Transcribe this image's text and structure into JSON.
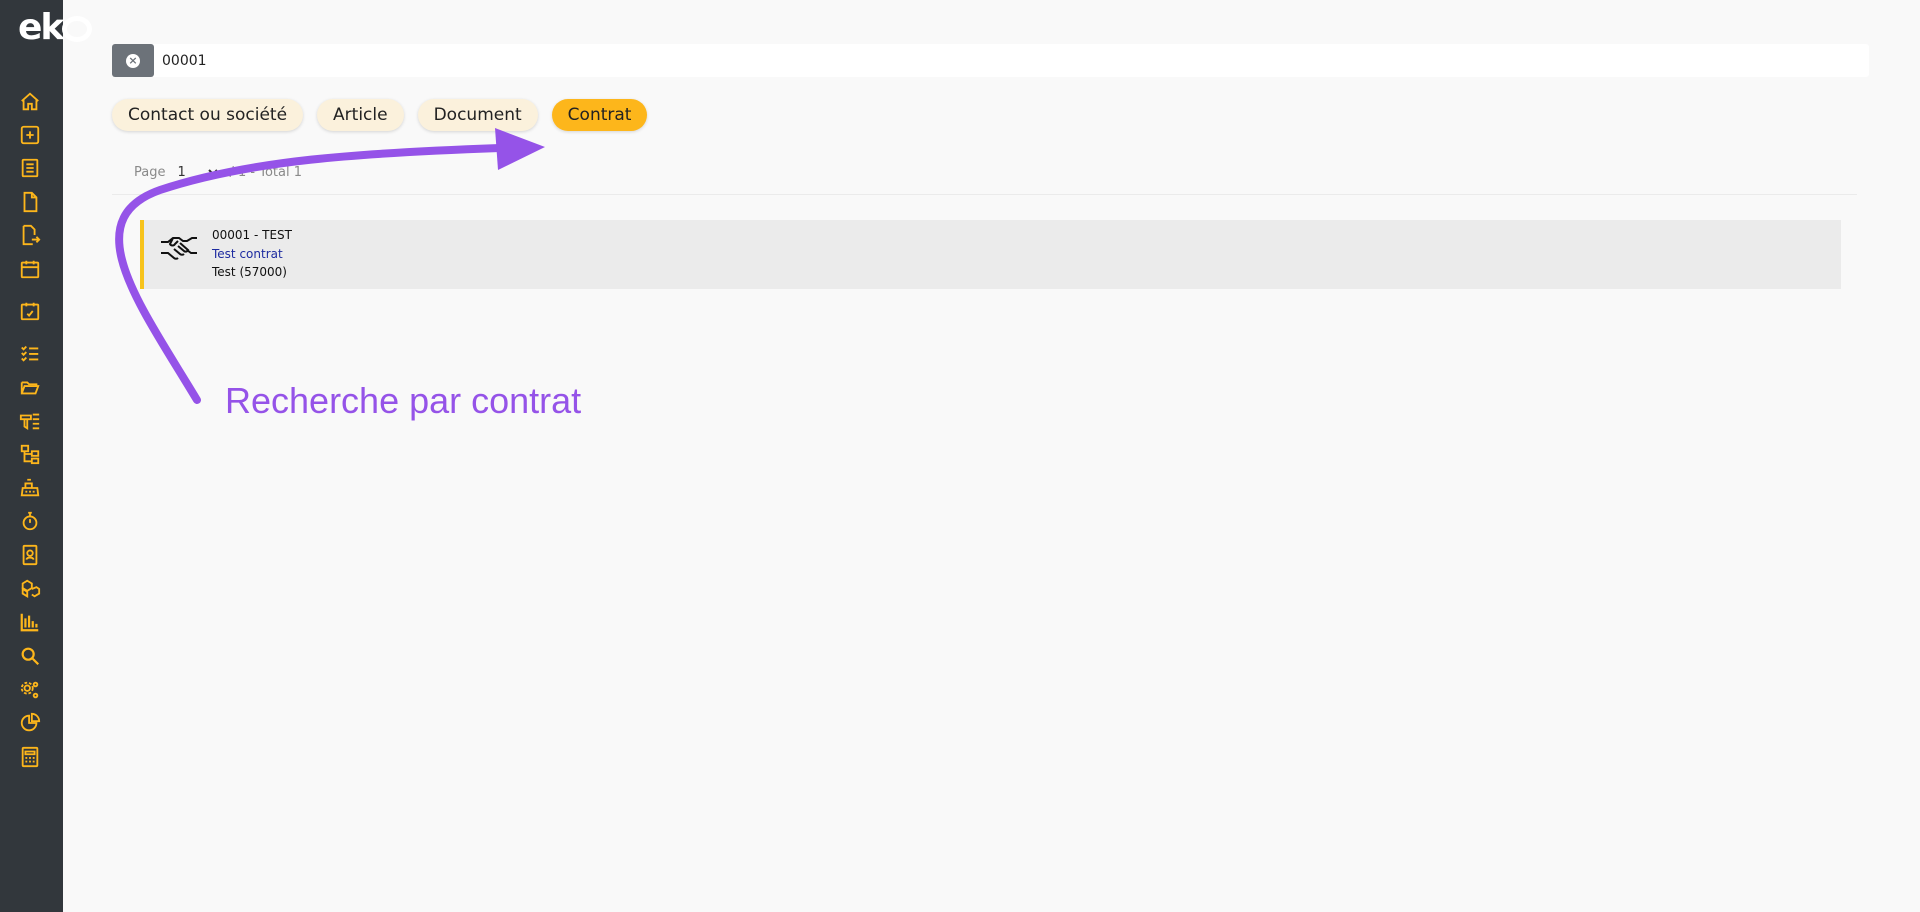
{
  "sidebar": {
    "logo_text": "ek",
    "items": [
      {
        "icon": "home-icon"
      },
      {
        "icon": "plus-square-icon"
      },
      {
        "icon": "list-icon"
      },
      {
        "icon": "file-icon"
      },
      {
        "icon": "file-export-icon"
      },
      {
        "icon": "calendar-icon"
      },
      {
        "icon": "calendar-check-icon"
      },
      {
        "icon": "tasks-icon"
      },
      {
        "icon": "folder-open-icon"
      },
      {
        "icon": "tools-icon"
      },
      {
        "icon": "sitemap-icon"
      },
      {
        "icon": "cash-register-icon"
      },
      {
        "icon": "stopwatch-icon"
      },
      {
        "icon": "contact-book-icon"
      },
      {
        "icon": "boxes-icon"
      },
      {
        "icon": "chart-bar-icon"
      },
      {
        "icon": "search-icon"
      },
      {
        "icon": "cogs-icon"
      },
      {
        "icon": "chart-pie-icon"
      },
      {
        "icon": "calculator-icon"
      }
    ],
    "accent_color": "#fdb61b",
    "background_color": "#32373c"
  },
  "search": {
    "value": "00001"
  },
  "filters": [
    {
      "label": "Contact ou société",
      "active": false
    },
    {
      "label": "Article",
      "active": false
    },
    {
      "label": "Document",
      "active": false
    },
    {
      "label": "Contrat",
      "active": true
    }
  ],
  "pager": {
    "label": "Page",
    "current": "1",
    "suffix": "/ 1 - Total 1"
  },
  "results": [
    {
      "icon": "handshake-icon",
      "title": "00001 - TEST",
      "subtitle": "Test contrat",
      "meta": "Test (57000)"
    }
  ],
  "annotation": {
    "text": "Recherche par contrat",
    "color": "#9553e8"
  }
}
